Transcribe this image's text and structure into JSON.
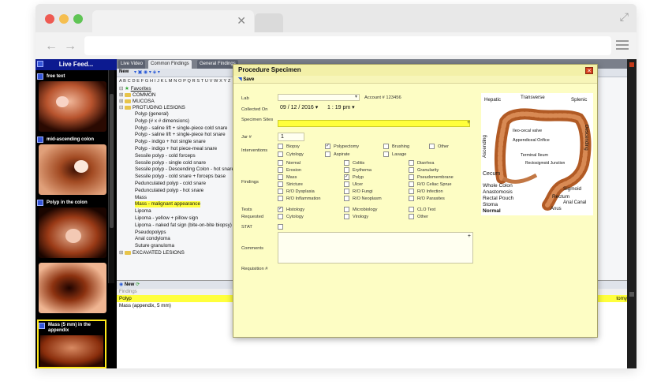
{
  "live_feed": {
    "title": "Live Feed...",
    "labels": [
      "free text",
      "mid-ascending colon",
      "Polyp in the colon",
      "Mass (5 mm) in the appendix"
    ]
  },
  "tabs": [
    "Live Video",
    "Common Findings",
    "General Findings"
  ],
  "findings_toolbar": {
    "new_label": "New"
  },
  "alphabet": "A B C D E F G H I J K L M N O P Q R S T U V W X Y Z",
  "tree": {
    "favorites": "Favorites",
    "folders_top": [
      "COMMON",
      "MUCOSA",
      "PROTUDING LESIONS"
    ],
    "items": [
      "Polyp (general)",
      "Polyp (# x # dimensions)",
      "Polyp - saline lift + single-piece cold snare",
      "Polyp - saline lift + single-piece hot snare",
      "Polyp - indigo + hot single snare",
      "Polyp - indigo + hot piece-meal snare",
      "Sessile polyp - cold forceps",
      "Sessile polyp - single cold snare",
      "Sessile polyp - Descending Colon - hot snare",
      "Sessile polyp - cold snare + forceps base",
      "Pedunculated polyp - cold snare",
      "Pedunculated polyp - hot snare",
      "Mass",
      "Mass - malignant appearance",
      "Lipoma",
      "Lipoma - yellow + pillow sign",
      "Lipoma - naked fat sign (bite-on-bite biopsy)",
      "Pseudopolyps",
      "Anal condyloma",
      "Suture granuloma"
    ],
    "selected": "Mass - malignant appearance",
    "folder_bottom": "EXCAVATED LESIONS"
  },
  "bottom_pane": {
    "new_label": "New",
    "header": "Findings",
    "rows": [
      "Polyp",
      "Mass (appendix, 5 mm)"
    ],
    "right_fragment": "tomy"
  },
  "modal": {
    "title": "Procedure Specimen",
    "save_label": "Save",
    "close_glyph": "✕",
    "labels": {
      "lab": "Lab",
      "account": "Account # 123456",
      "collected_on": "Collected On",
      "specimen_sites": "Specimen Sites",
      "jar": "Jar #",
      "interventions": "Interventions",
      "findings": "Findings",
      "tests_requested": "Tests Requested",
      "stat": "STAT",
      "comments": "Comments",
      "requisition": "Requisition #"
    },
    "date": "09 / 12 / 2016",
    "time": "1 : 19  pm",
    "jar_value": "1",
    "interventions": [
      {
        "label": "Biopsy",
        "checked": false
      },
      {
        "label": "Polypectomy",
        "checked": true
      },
      {
        "label": "Brushing",
        "checked": false
      },
      {
        "label": "Other",
        "checked": false
      },
      {
        "label": "Cytology",
        "checked": false
      },
      {
        "label": "Aspirate",
        "checked": false
      },
      {
        "label": "Lavage",
        "checked": false
      }
    ],
    "findings_col1": [
      "Normal",
      "Erosion",
      "Mass",
      "Stricture",
      "R/O Dysplasia",
      "R/O Inflammation"
    ],
    "findings_col2": [
      "Colitis",
      "Erythema",
      "Polyp",
      "Ulcer",
      "R/O Fungi",
      "R/O Neoplasm"
    ],
    "findings_col3": [
      "Diarrhea",
      "Granularity",
      "Pseudomembrane",
      "R/O Celiac Sprue",
      "R/O Infection",
      "R/O Parasites"
    ],
    "findings_checked": "Polyp",
    "tests": [
      {
        "label": "Histology",
        "checked": true
      },
      {
        "label": "Microbiology",
        "checked": false
      },
      {
        "label": "CLO Test",
        "checked": false
      },
      {
        "label": "Cytology",
        "checked": false
      },
      {
        "label": "Virology",
        "checked": false
      },
      {
        "label": "Other",
        "checked": false
      }
    ],
    "anatomy": {
      "labels": [
        "Hepatic",
        "Transverse",
        "Splenic",
        "Ascending",
        "Descending",
        "Ileo-cecal valve",
        "Appendiceal Orifice",
        "Terminal Ileum",
        "Rectosigmoid Junction",
        "Cecum",
        "Sigmoid",
        "Whole Colon",
        "Anastomosis",
        "Rectal Pouch",
        "Stoma",
        "Normal",
        "Rectum",
        "Anal Canal",
        "Anus"
      ]
    }
  },
  "colors": {
    "modal_bg": "#fdfdc4",
    "highlight": "#ffff3c",
    "live_feed_header": "#0c1a90",
    "close_red": "#d8401e"
  }
}
